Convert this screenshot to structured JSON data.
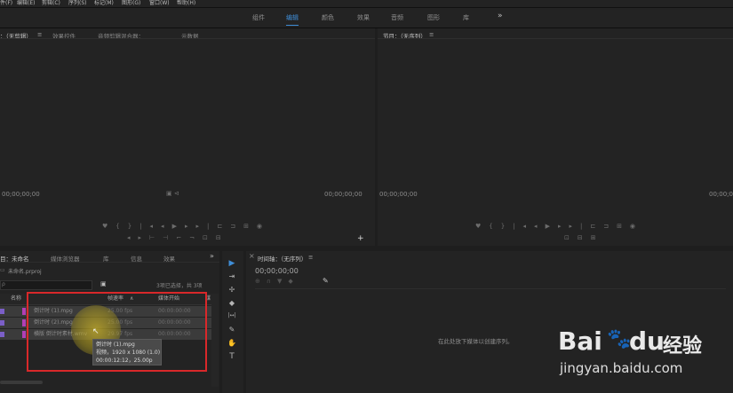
{
  "menu": [
    "件(F)",
    "编辑(E)",
    "剪辑(C)",
    "序列(S)",
    "标记(M)",
    "图形(G)",
    "窗口(W)",
    "帮助(H)"
  ],
  "workspaces": {
    "items": [
      "组件",
      "编辑",
      "颜色",
      "效果",
      "音频",
      "图形",
      "库"
    ],
    "active_index": 1,
    "more": "»"
  },
  "source_panel": {
    "tabs": [
      "：（无剪辑）",
      "效果控件",
      "音频剪辑混合器：",
      "元数据"
    ],
    "menu_glyph": "≡",
    "timecode_left": "00;00;00;00",
    "timecode_right": "00;00;00;00",
    "add_glyph": "+"
  },
  "program_panel": {
    "title": "节目：（无序列）",
    "menu_glyph": "≡",
    "timecode_left": "00;00;00;00",
    "timecode_right": "00;00;00;00"
  },
  "project_panel": {
    "tabs": [
      "目：未命名",
      "媒体浏览器",
      "库",
      "信息",
      "效果"
    ],
    "more": "»",
    "file": "未命名.prproj",
    "search_placeholder": "ρ",
    "selection_info": "3项已选择，共 3项",
    "columns": [
      "名称",
      "帧速率",
      "媒体开始",
      "媒"
    ],
    "sort_glyph": "∧",
    "items": [
      {
        "name": "倒计时 (1).mpg",
        "fps": "25.00 fps",
        "start": "00:00:00:00"
      },
      {
        "name": "倒计时 (2).mpg",
        "fps": "25.00 fps",
        "start": "00:00:00:00"
      },
      {
        "name": "横版 倒计时素材.wmv",
        "fps": "29.97 fps",
        "start": "00:00:00:00"
      }
    ],
    "tooltip": [
      "倒计时 (1).mpg",
      "视频，1920 x 1080 (1.0)",
      "00:00:12:12，25.00p"
    ],
    "colors": {
      "label": "#b13fb5",
      "highlight": "#d9282a"
    }
  },
  "timeline_panel": {
    "close_glyph": "×",
    "title": "时间轴：（无序列）",
    "menu_glyph": "≡",
    "timecode": "00;00;00;00",
    "hint": "在此处放下媒体以创建序列。"
  },
  "tools": [
    "▶",
    "⇥",
    "✢",
    "◆",
    "|↔|",
    "✎",
    "✋",
    "T"
  ],
  "watermark": {
    "brand": "Bai",
    "paw": "🐾",
    "du": "du",
    "jingyan": "经验",
    "url": "jingyan.baidu.com"
  }
}
